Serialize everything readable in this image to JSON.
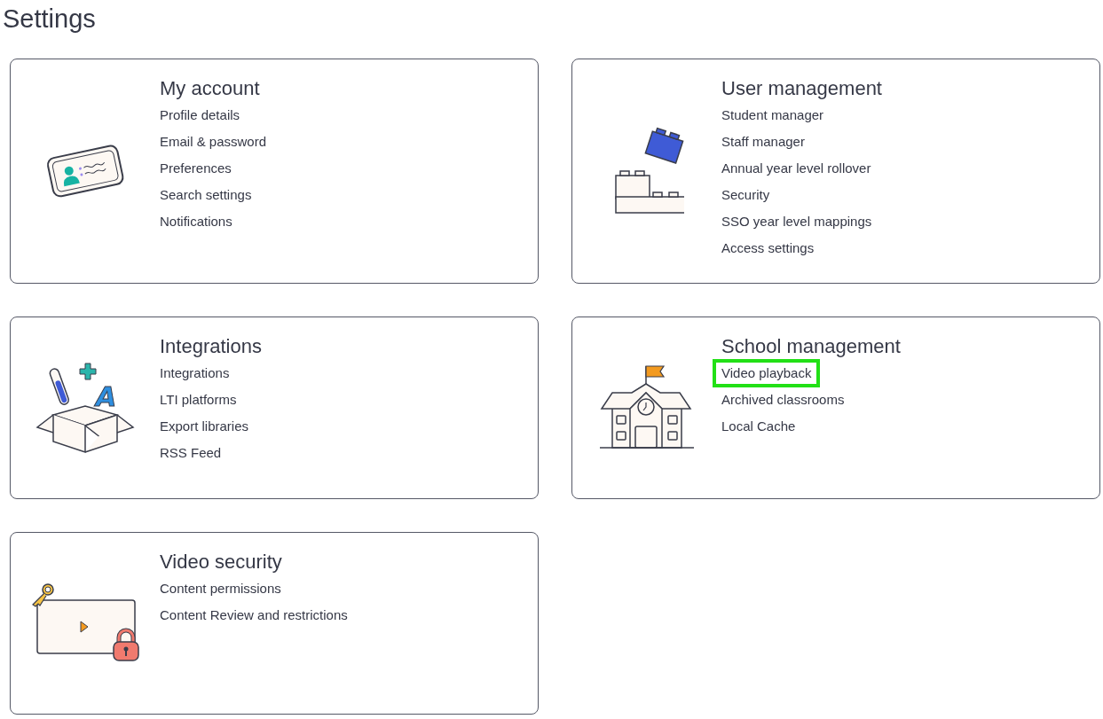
{
  "page": {
    "title": "Settings"
  },
  "cards": [
    {
      "title": "My account",
      "kind": "id-card",
      "links": [
        {
          "label": "Profile details",
          "highlighted": false
        },
        {
          "label": "Email & password",
          "highlighted": false
        },
        {
          "label": "Preferences",
          "highlighted": false
        },
        {
          "label": "Search settings",
          "highlighted": false
        },
        {
          "label": "Notifications",
          "highlighted": false
        }
      ]
    },
    {
      "title": "User management",
      "kind": "blocks",
      "links": [
        {
          "label": "Student manager",
          "highlighted": false
        },
        {
          "label": "Staff manager",
          "highlighted": false
        },
        {
          "label": "Annual year level rollover",
          "highlighted": false
        },
        {
          "label": "Security",
          "highlighted": false
        },
        {
          "label": "SSO year level mappings",
          "highlighted": false
        },
        {
          "label": "Access settings",
          "highlighted": false
        }
      ]
    },
    {
      "title": "Integrations",
      "kind": "box",
      "illustration_letter": "A",
      "links": [
        {
          "label": "Integrations",
          "highlighted": false
        },
        {
          "label": "LTI platforms",
          "highlighted": false
        },
        {
          "label": "Export libraries",
          "highlighted": false
        },
        {
          "label": "RSS Feed",
          "highlighted": false
        }
      ]
    },
    {
      "title": "School management",
      "kind": "school",
      "links": [
        {
          "label": "Video playback",
          "highlighted": true
        },
        {
          "label": "Archived classrooms",
          "highlighted": false
        },
        {
          "label": "Local Cache",
          "highlighted": false
        }
      ]
    },
    {
      "title": "Video security",
      "kind": "video-lock",
      "links": [
        {
          "label": "Content permissions",
          "highlighted": false
        },
        {
          "label": "Content Review and restrictions",
          "highlighted": false
        }
      ]
    }
  ]
}
